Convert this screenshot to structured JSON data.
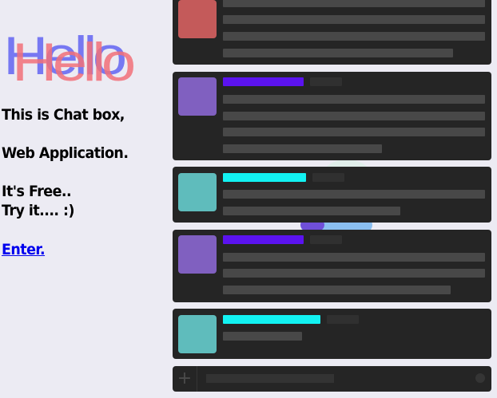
{
  "hero": {
    "hello": "Hello",
    "line1": "This is Chat box,",
    "line2": "Web Application.",
    "line3": "It's Free..",
    "line4": "Try it.... :)",
    "enter_link": "Enter."
  },
  "colors": {
    "background": "#ecebf3",
    "hello_blue": "#6b6cf2",
    "hello_red": "#f2707a",
    "card": "#252525",
    "avatar_red": "#c45a5a",
    "avatar_purple": "#8060c0",
    "avatar_teal": "#5fbcbc",
    "name_purple": "#5b13f0",
    "name_cyan": "#12f2f2",
    "link": "#0000ee"
  },
  "chat": {
    "messages": [
      {
        "avatar": "avatar_red"
      },
      {
        "avatar": "avatar_purple",
        "name_color": "name_purple"
      },
      {
        "avatar": "avatar_teal",
        "name_color": "name_cyan"
      },
      {
        "avatar": "avatar_purple",
        "name_color": "name_purple"
      },
      {
        "avatar": "avatar_teal",
        "name_color": "name_cyan"
      }
    ],
    "composer": {
      "add_icon": "plus-icon",
      "emoji_icon": "emoji-icon"
    }
  }
}
